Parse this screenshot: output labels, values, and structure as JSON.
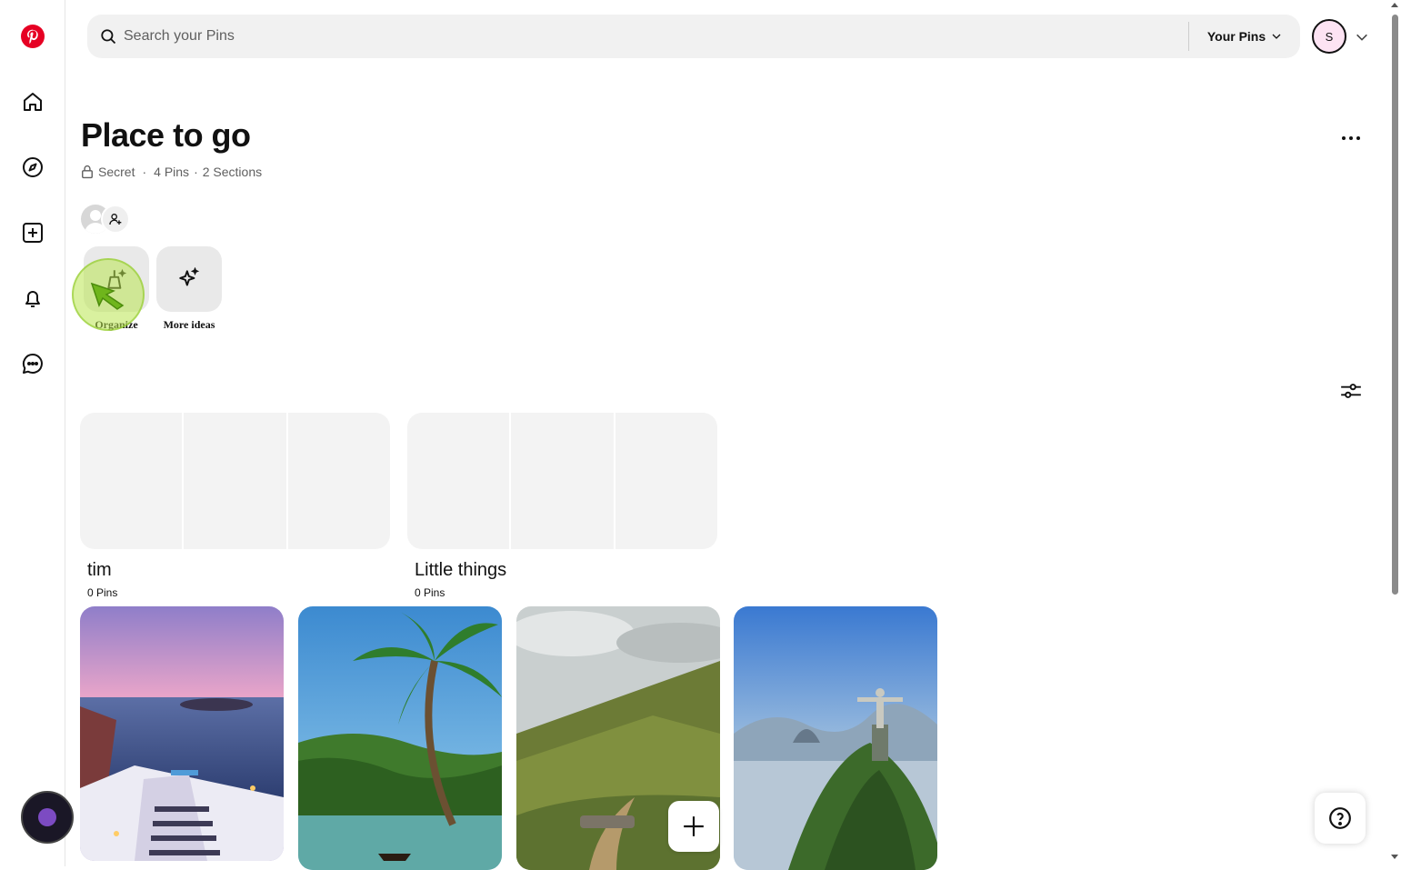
{
  "sidebar": {
    "items": [
      {
        "icon": "pinterest-logo-icon"
      },
      {
        "icon": "home-icon"
      },
      {
        "icon": "explore-compass-icon"
      },
      {
        "icon": "create-plus-icon"
      },
      {
        "icon": "notifications-bell-icon"
      },
      {
        "icon": "messages-icon"
      }
    ]
  },
  "search": {
    "placeholder": "Search your Pins",
    "value": ""
  },
  "header": {
    "scope_label": "Your Pins",
    "avatar_initial": "S"
  },
  "board": {
    "title": "Place to go",
    "privacy": "Secret",
    "pins_count": "4 Pins",
    "sections_count": "2 Sections",
    "separator": "·"
  },
  "actions": {
    "organize_label": "Organize",
    "more_ideas_label": "More ideas"
  },
  "sections": [
    {
      "name": "tim",
      "count": "0 Pins"
    },
    {
      "name": "Little things",
      "count": "0 Pins"
    }
  ],
  "pins": [
    {
      "subject": "Santorini sunset stairs"
    },
    {
      "subject": "Palm tree by river"
    },
    {
      "subject": "Green valley path"
    },
    {
      "subject": "Christ the Redeemer, Rio"
    }
  ],
  "colors": {
    "brand": "#e60023",
    "cursor_highlight": "#b7e34f",
    "search_bg": "#f1f1f1",
    "avatar_bg": "#fde3f3"
  }
}
